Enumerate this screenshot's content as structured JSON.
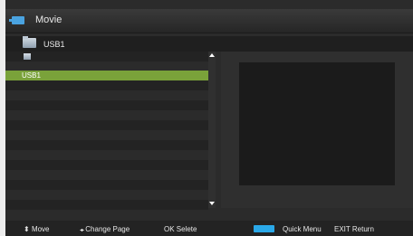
{
  "window": {
    "title": "Movie",
    "icon": "movie-icon"
  },
  "path": {
    "label": "USB1",
    "icon": "folder-icon"
  },
  "file_list": {
    "items": [
      {
        "label": "",
        "icon": "up-folder-icon"
      },
      {
        "label": "USB1",
        "selected": true
      }
    ],
    "scroll_up_icon": "triangle-up-icon",
    "scroll_down_icon": "triangle-down-icon"
  },
  "help": {
    "move_glyph": "⬍",
    "move": "Move",
    "change_page_glyph": "◂▸",
    "change_page": "Change Page",
    "ok_key": "OK",
    "ok_action": "Selete",
    "quick_menu_color": "#2aa8e8",
    "quick_menu": "Quick Menu",
    "exit_key": "EXIT",
    "exit_action": "Return"
  },
  "colors": {
    "selection": "#7aa23a",
    "accent": "#2aa8e8",
    "background": "#2b2b2b"
  }
}
